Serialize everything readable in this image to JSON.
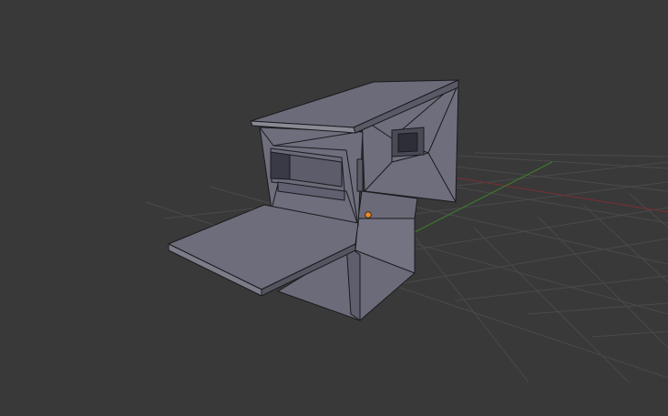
{
  "viewport": {
    "view": "3d-viewport-perspective",
    "background_color": "#393939",
    "grid_color": "#4a4a4a",
    "x_axis_color": "#7a2f2f",
    "y_axis_color": "#3f7f2a",
    "origin_color": "#f08a2a"
  },
  "object": {
    "name": "",
    "shading": "solid",
    "face_color": "#6b6b7a",
    "face_dark_color": "#5a5a68",
    "face_light_color": "#80808e",
    "edge_color": "#1a1a1e"
  }
}
